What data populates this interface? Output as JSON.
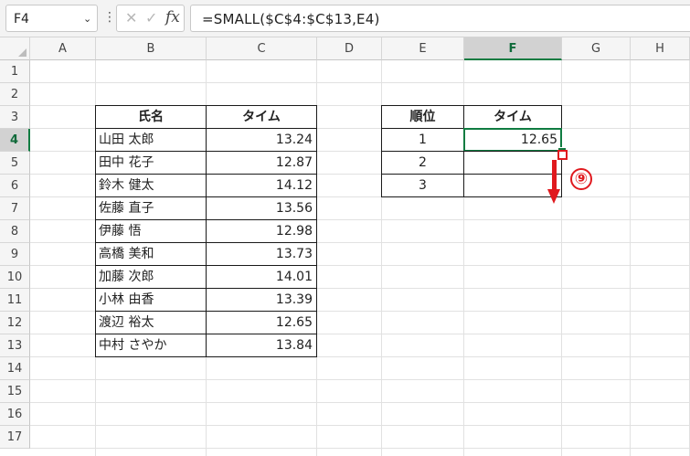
{
  "formula_bar": {
    "name_box": "F4",
    "dropdown_icon": "chevron-down-icon",
    "more_icon": "vertical-dots-icon",
    "cancel_icon": "cross-icon",
    "enter_icon": "check-icon",
    "function_icon": "fx-icon",
    "function_glyph": "fx",
    "formula": "=SMALL($C$4:$C$13,E4)"
  },
  "columns": [
    "A",
    "B",
    "C",
    "D",
    "E",
    "F",
    "G",
    "H"
  ],
  "rows": [
    "1",
    "2",
    "3",
    "4",
    "5",
    "6",
    "7",
    "8",
    "9",
    "10",
    "11",
    "12",
    "13",
    "14",
    "15",
    "16",
    "17"
  ],
  "selected_column": "F",
  "selected_row": "4",
  "source_table": {
    "headers": [
      "氏名",
      "タイム"
    ],
    "rows": [
      {
        "name": "山田 太郎",
        "time": "13.24"
      },
      {
        "name": "田中 花子",
        "time": "12.87"
      },
      {
        "name": "鈴木 健太",
        "time": "14.12"
      },
      {
        "name": "佐藤 直子",
        "time": "13.56"
      },
      {
        "name": "伊藤 悟",
        "time": "12.98"
      },
      {
        "name": "高橋 美和",
        "time": "13.73"
      },
      {
        "name": "加藤 次郎",
        "time": "14.01"
      },
      {
        "name": "小林 由香",
        "time": "13.39"
      },
      {
        "name": "渡辺 裕太",
        "time": "12.65"
      },
      {
        "name": "中村 さやか",
        "time": "13.84"
      }
    ]
  },
  "rank_table": {
    "headers": [
      "順位",
      "タイム"
    ],
    "rows": [
      {
        "rank": "1",
        "time": "12.65"
      },
      {
        "rank": "2",
        "time": ""
      },
      {
        "rank": "3",
        "time": ""
      }
    ]
  },
  "annotation": {
    "step_label": "⑨",
    "color": "#e0191e",
    "icon": "drag-down-arrow-icon"
  },
  "colors": {
    "selection": "#107c41",
    "annotation": "#e0191e"
  }
}
